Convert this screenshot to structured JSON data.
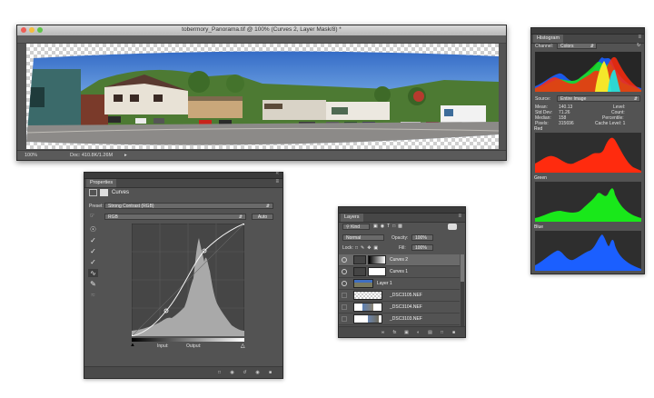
{
  "document": {
    "title": "tobermory_Panorama.tif @ 100% (Curves 2, Layer Mask/8) *",
    "zoom": "100%",
    "doc_size": "Doc: 410.8K/1.26M",
    "traffic_colors": [
      "#ee5e56",
      "#f5bd3d",
      "#5ec548"
    ]
  },
  "properties": {
    "tab": "Properties",
    "panel_title": "Curves",
    "preset_label": "Preset:",
    "preset_value": "Strong Contrast (RGB)",
    "channel_value": "RGB",
    "auto_button": "Auto",
    "input_label": "Input:",
    "output_label": "Output:",
    "tools": [
      "sample-point-icon",
      "eyedropper-black-icon",
      "eyedropper-gray-icon",
      "eyedropper-white-icon",
      "curve-smooth-icon",
      "pencil-icon",
      "smooth-curve-icon"
    ],
    "footer": [
      "clip-icon",
      "view-previous-icon",
      "reset-icon",
      "visibility-icon",
      "trash-icon"
    ]
  },
  "layers": {
    "tab": "Layers",
    "filter_kind": "Kind",
    "blend_mode": "Normal",
    "opacity_label": "Opacity:",
    "opacity_value": "100%",
    "lock_label": "Lock:",
    "fill_label": "Fill:",
    "fill_value": "100%",
    "items": [
      {
        "name": "Curves 2",
        "selected": true,
        "kind": "adjustment"
      },
      {
        "name": "Curves 1",
        "selected": false,
        "kind": "adjustment"
      },
      {
        "name": "Layer 1",
        "selected": false,
        "kind": "pixel"
      },
      {
        "name": "_DSC3105.NEF",
        "selected": false,
        "kind": "pixel"
      },
      {
        "name": "_DSC3104.NEF",
        "selected": false,
        "kind": "pixel"
      },
      {
        "name": "_DSC3103.NEF",
        "selected": false,
        "kind": "pixel"
      }
    ],
    "footer": [
      "link-icon",
      "fx-icon",
      "mask-icon",
      "adjustment-icon",
      "folder-icon",
      "new-layer-icon",
      "trash-icon"
    ]
  },
  "histogram": {
    "tab": "Histogram",
    "channel_label": "Channel:",
    "channel_value": "Colors",
    "source_label": "Source:",
    "source_value": "Entire Image",
    "stats_left": [
      {
        "label": "Mean:",
        "value": "140.13"
      },
      {
        "label": "Std Dev:",
        "value": "71.26"
      },
      {
        "label": "Median:",
        "value": "158"
      },
      {
        "label": "Pixels:",
        "value": "315696"
      }
    ],
    "stats_right": [
      "Level:",
      "Count:",
      "Percentile:",
      "Cache Level: 1"
    ],
    "sections": [
      {
        "name": "Red",
        "color": "#ff2b0e"
      },
      {
        "name": "Green",
        "color": "#19e81a"
      },
      {
        "name": "Blue",
        "color": "#1b5fff"
      }
    ]
  }
}
